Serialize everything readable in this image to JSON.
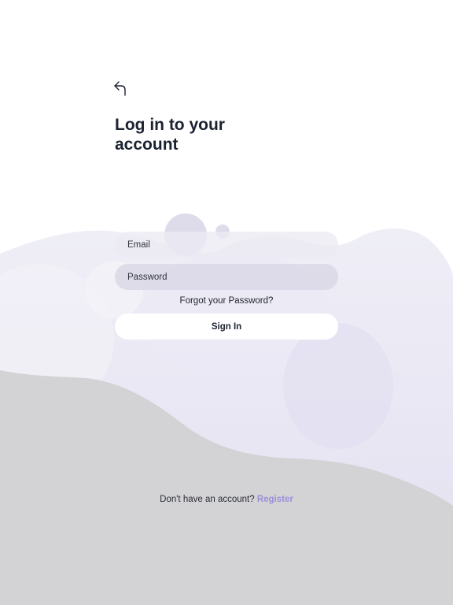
{
  "header": {
    "back_icon": "back-arrow-icon",
    "title": "Log in to your account"
  },
  "form": {
    "email_placeholder": "Email",
    "password_placeholder": "Password",
    "forgot_label": "Forgot your Password?",
    "signin_label": "Sign In"
  },
  "footer": {
    "prompt": "Don't have an account?",
    "register_label": "Register"
  },
  "colors": {
    "title": "#1b2230",
    "accent": "#9d8ed8",
    "lavender_background": "#e6e3f2",
    "gray_background": "#d3d3d5"
  }
}
